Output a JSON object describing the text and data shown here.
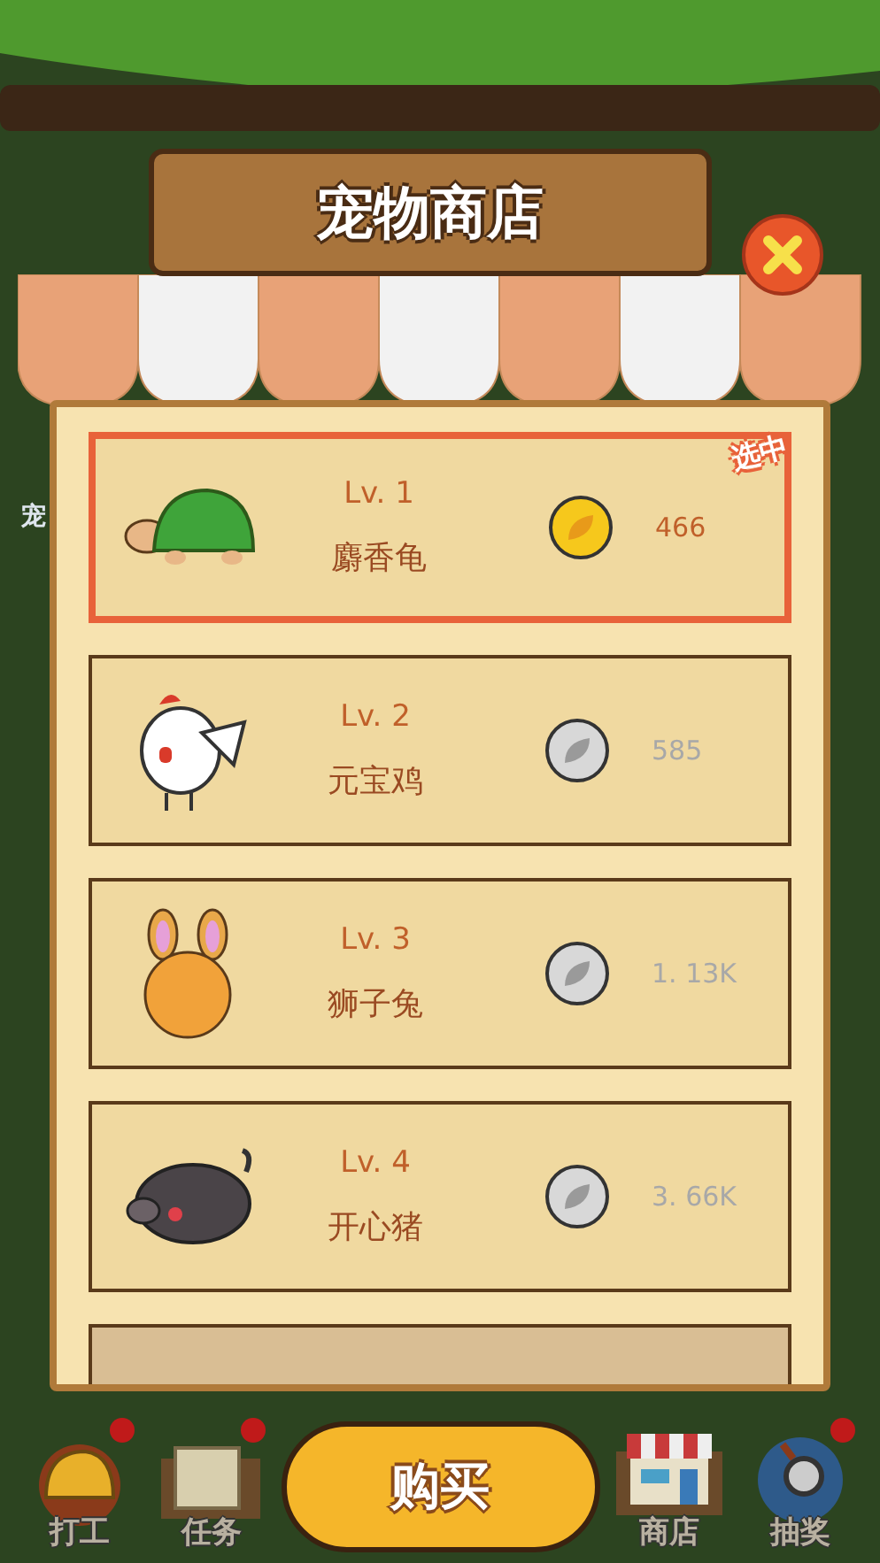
{
  "title": "宠物商店",
  "background_label": "宠",
  "pets": [
    {
      "kind": "turtle",
      "level": "Lv. 1",
      "name": "麝香龟",
      "price": "466",
      "affordable": true,
      "selected": true,
      "tag": "选中"
    },
    {
      "kind": "chicken",
      "level": "Lv. 2",
      "name": "元宝鸡",
      "price": "585",
      "affordable": false,
      "selected": false
    },
    {
      "kind": "rabbit",
      "level": "Lv. 3",
      "name": "狮子兔",
      "price": "1. 13K",
      "affordable": false,
      "selected": false
    },
    {
      "kind": "boar",
      "level": "Lv. 4",
      "name": "开心猪",
      "price": "3. 66K",
      "affordable": false,
      "selected": false
    }
  ],
  "buy_button": "购买",
  "nav": [
    {
      "kind": "helmet",
      "label": "打工",
      "badge": true
    },
    {
      "kind": "scroll",
      "label": "任务",
      "badge": true
    },
    {
      "kind": "shop",
      "label": "商店",
      "badge": false
    },
    {
      "kind": "lottery",
      "label": "抽奖",
      "badge": true
    }
  ]
}
